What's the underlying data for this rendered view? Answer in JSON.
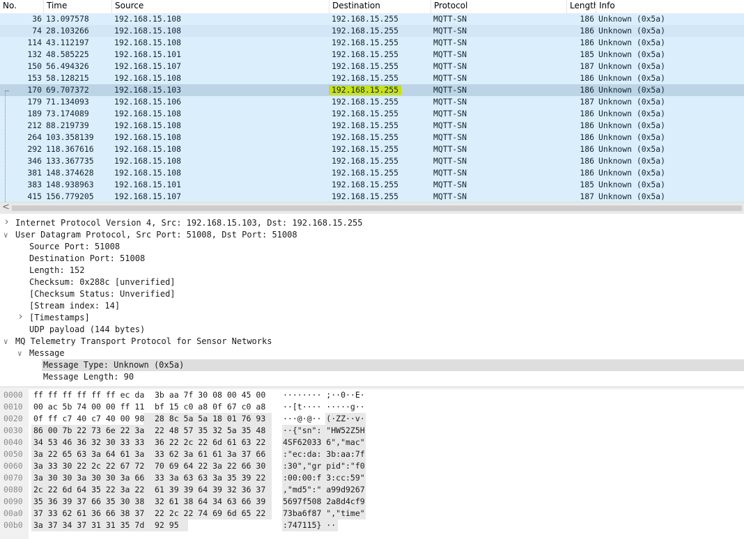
{
  "packet_list": {
    "columns": [
      "No.",
      "Time",
      "Source",
      "Destination",
      "Protocol",
      "Length",
      "Info"
    ],
    "rows": [
      {
        "no": "36",
        "time": "13.097578",
        "src": "192.168.15.108",
        "dst": "192.168.15.255",
        "proto": "MQTT-SN",
        "len": "186",
        "info": "Unknown (0x5a)"
      },
      {
        "no": "74",
        "time": "28.103266",
        "src": "192.168.15.108",
        "dst": "192.168.15.255",
        "proto": "MQTT-SN",
        "len": "186",
        "info": "Unknown (0x5a)"
      },
      {
        "no": "114",
        "time": "43.112197",
        "src": "192.168.15.108",
        "dst": "192.168.15.255",
        "proto": "MQTT-SN",
        "len": "186",
        "info": "Unknown (0x5a)"
      },
      {
        "no": "132",
        "time": "48.585225",
        "src": "192.168.15.101",
        "dst": "192.168.15.255",
        "proto": "MQTT-SN",
        "len": "185",
        "info": "Unknown (0x5a)"
      },
      {
        "no": "150",
        "time": "56.494326",
        "src": "192.168.15.107",
        "dst": "192.168.15.255",
        "proto": "MQTT-SN",
        "len": "187",
        "info": "Unknown (0x5a)"
      },
      {
        "no": "153",
        "time": "58.128215",
        "src": "192.168.15.108",
        "dst": "192.168.15.255",
        "proto": "MQTT-SN",
        "len": "186",
        "info": "Unknown (0x5a)"
      },
      {
        "no": "170",
        "time": "69.707372",
        "src": "192.168.15.103",
        "dst": "192.168.15.255",
        "proto": "MQTT-SN",
        "len": "186",
        "info": "Unknown (0x5a)"
      },
      {
        "no": "179",
        "time": "71.134093",
        "src": "192.168.15.106",
        "dst": "192.168.15.255",
        "proto": "MQTT-SN",
        "len": "187",
        "info": "Unknown (0x5a)"
      },
      {
        "no": "189",
        "time": "73.174089",
        "src": "192.168.15.108",
        "dst": "192.168.15.255",
        "proto": "MQTT-SN",
        "len": "186",
        "info": "Unknown (0x5a)"
      },
      {
        "no": "212",
        "time": "88.219739",
        "src": "192.168.15.108",
        "dst": "192.168.15.255",
        "proto": "MQTT-SN",
        "len": "186",
        "info": "Unknown (0x5a)"
      },
      {
        "no": "264",
        "time": "103.358139",
        "src": "192.168.15.108",
        "dst": "192.168.15.255",
        "proto": "MQTT-SN",
        "len": "186",
        "info": "Unknown (0x5a)"
      },
      {
        "no": "292",
        "time": "118.367616",
        "src": "192.168.15.108",
        "dst": "192.168.15.255",
        "proto": "MQTT-SN",
        "len": "186",
        "info": "Unknown (0x5a)"
      },
      {
        "no": "346",
        "time": "133.367735",
        "src": "192.168.15.108",
        "dst": "192.168.15.255",
        "proto": "MQTT-SN",
        "len": "186",
        "info": "Unknown (0x5a)"
      },
      {
        "no": "381",
        "time": "148.374628",
        "src": "192.168.15.108",
        "dst": "192.168.15.255",
        "proto": "MQTT-SN",
        "len": "186",
        "info": "Unknown (0x5a)"
      },
      {
        "no": "383",
        "time": "148.938963",
        "src": "192.168.15.101",
        "dst": "192.168.15.255",
        "proto": "MQTT-SN",
        "len": "185",
        "info": "Unknown (0x5a)"
      },
      {
        "no": "415",
        "time": "156.779205",
        "src": "192.168.15.107",
        "dst": "192.168.15.255",
        "proto": "MQTT-SN",
        "len": "187",
        "info": "Unknown (0x5a)"
      }
    ],
    "selected_no": "170",
    "row_color": "#dbeefc",
    "selected_color": "#bcd4e6",
    "highlight_color": "#c7e01d"
  },
  "scrollbar": {
    "left_arrow": "<"
  },
  "details": [
    {
      "text": "Internet Protocol Version 4, Src: 192.168.15.103, Dst: 192.168.15.255",
      "expander": "collapsed"
    },
    {
      "text": "User Datagram Protocol, Src Port: 51008, Dst Port: 51008",
      "expander": "expanded"
    },
    {
      "text": "Source Port: 51008",
      "expander": "none"
    },
    {
      "text": "Destination Port: 51008",
      "expander": "none"
    },
    {
      "text": "Length: 152",
      "expander": "none"
    },
    {
      "text": "Checksum: 0x288c [unverified]",
      "expander": "none"
    },
    {
      "text": "[Checksum Status: Unverified]",
      "expander": "none"
    },
    {
      "text": "[Stream index: 14]",
      "expander": "none"
    },
    {
      "text": "[Timestamps]",
      "expander": "collapsed"
    },
    {
      "text": "UDP payload (144 bytes)",
      "expander": "none"
    },
    {
      "text": "MQ Telemetry Transport Protocol for Sensor Networks",
      "expander": "expanded"
    },
    {
      "text": "Message",
      "expander": "expanded"
    },
    {
      "text": "Message Type: Unknown (0x5a)",
      "expander": "none",
      "highlighted": true
    },
    {
      "text": "Message Length: 90",
      "expander": "none"
    }
  ],
  "bytes": [
    {
      "off": "0000",
      "hex1": "ff ff ff ff ff ff ec da",
      "hex2": "3b aa 7f 30 08 00 45 00",
      "ascii": "········ ;··0··E·"
    },
    {
      "off": "0010",
      "hex1": "00 ac 5b 74 00 00 ff 11",
      "hex2": "bf 15 c0 a8 0f 67 c0 a8",
      "ascii": "··[t···· ·····g··"
    },
    {
      "off": "0020",
      "hex1": "0f ff c7 40 c7 40 00 98",
      "hex2": "28 8c 5a 5a 18 01 76 93",
      "ascii": "···@·@·· (·ZZ··v·"
    },
    {
      "off": "0030",
      "hex1": "86 00 7b 22 73 6e 22 3a",
      "hex2": "22 48 57 35 32 5a 35 48",
      "ascii": "··{\"sn\": \"HW52Z5H"
    },
    {
      "off": "0040",
      "hex1": "34 53 46 36 32 30 33 33",
      "hex2": "36 22 2c 22 6d 61 63 22",
      "ascii": "4SF62033 6\",\"mac\""
    },
    {
      "off": "0050",
      "hex1": "3a 22 65 63 3a 64 61 3a",
      "hex2": "33 62 3a 61 61 3a 37 66",
      "ascii": ":\"ec:da: 3b:aa:7f"
    },
    {
      "off": "0060",
      "hex1": "3a 33 30 22 2c 22 67 72",
      "hex2": "70 69 64 22 3a 22 66 30",
      "ascii": ":30\",\"gr pid\":\"f0"
    },
    {
      "off": "0070",
      "hex1": "3a 30 30 3a 30 30 3a 66",
      "hex2": "33 3a 63 63 3a 35 39 22",
      "ascii": ":00:00:f 3:cc:59\""
    },
    {
      "off": "0080",
      "hex1": "2c 22 6d 64 35 22 3a 22",
      "hex2": "61 39 39 64 39 32 36 37",
      "ascii": ",\"md5\":\" a99d9267"
    },
    {
      "off": "0090",
      "hex1": "35 36 39 37 66 35 30 38",
      "hex2": "32 61 38 64 34 63 66 39",
      "ascii": "5697f508 2a8d4cf9"
    },
    {
      "off": "00a0",
      "hex1": "37 33 62 61 36 66 38 37",
      "hex2": "22 2c 22 74 69 6d 65 22",
      "ascii": "73ba6f87 \",\"time\""
    },
    {
      "off": "00b0",
      "hex1": "3a 37 34 37 31 31 35 7d",
      "hex2": "92 95",
      "ascii": ":747115} ··"
    }
  ]
}
